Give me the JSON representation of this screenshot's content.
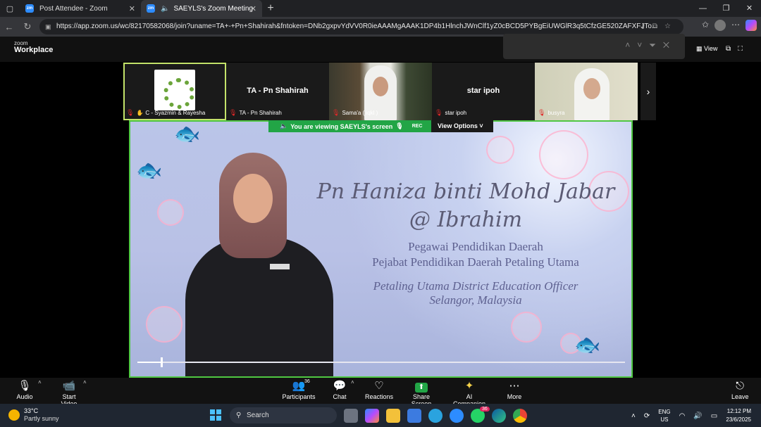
{
  "browser": {
    "tabs": [
      {
        "label": "Post Attendee - Zoom",
        "favicon": "zm"
      },
      {
        "label": "SAEYLS's Zoom Meeting",
        "favicon": "zm",
        "audio": "speaker-icon"
      }
    ],
    "url": "https://app.zoom.us/wc/82170582068/join?uname=TA+-+Pn+Shahirah&fntoken=DNb2gxpvYdVV0R0ieAAAMgAAAK1DP4b1HlnchJWnClf1yZ0cBCD5PYBgEiUWGlR3q5tCfzGE520ZAFXFJTo..."
  },
  "zoom": {
    "logo_top": "zoom",
    "logo_bottom": "Workplace",
    "view_label": "View",
    "thumbnails": [
      {
        "name": "C - Syazmin & Rayesha",
        "big": ""
      },
      {
        "name": "TA - Pn Shahirah",
        "big": "TA - Pn Shahirah"
      },
      {
        "name": "Sama'a ( iqkl )",
        "big": ""
      },
      {
        "name": "star ipoh",
        "big": "star ipoh"
      },
      {
        "name": "busyra",
        "big": ""
      }
    ],
    "viewing_banner": "You are viewing  SAEYLS's screen",
    "rec_label": "REC",
    "view_options": "View Options",
    "slide": {
      "title": "Pn Haniza binti Mohd Jabar @ Ibrahim",
      "line1": "Pegawai Pendidikan Daerah",
      "line2": "Pejabat Pendidikan Daerah Petaling Utama",
      "line3": "Petaling Utama District Education Officer",
      "line4": "Selangor, Malaysia",
      "video_progress": 0.047
    },
    "toolbar": {
      "audio": "Audio",
      "start_video": "Start Video",
      "participants": "Participants",
      "participants_count": "36",
      "chat": "Chat",
      "reactions": "Reactions",
      "share_screen": "Share Screen",
      "ai_companion": "AI Companion",
      "more": "More",
      "leave": "Leave"
    }
  },
  "taskbar": {
    "temperature": "33°C",
    "condition": "Partly sunny",
    "search": "Search",
    "lang_top": "ENG",
    "lang_bottom": "US",
    "time": "12:12 PM",
    "date": "23/6/2025",
    "zoom_badge": "36"
  }
}
